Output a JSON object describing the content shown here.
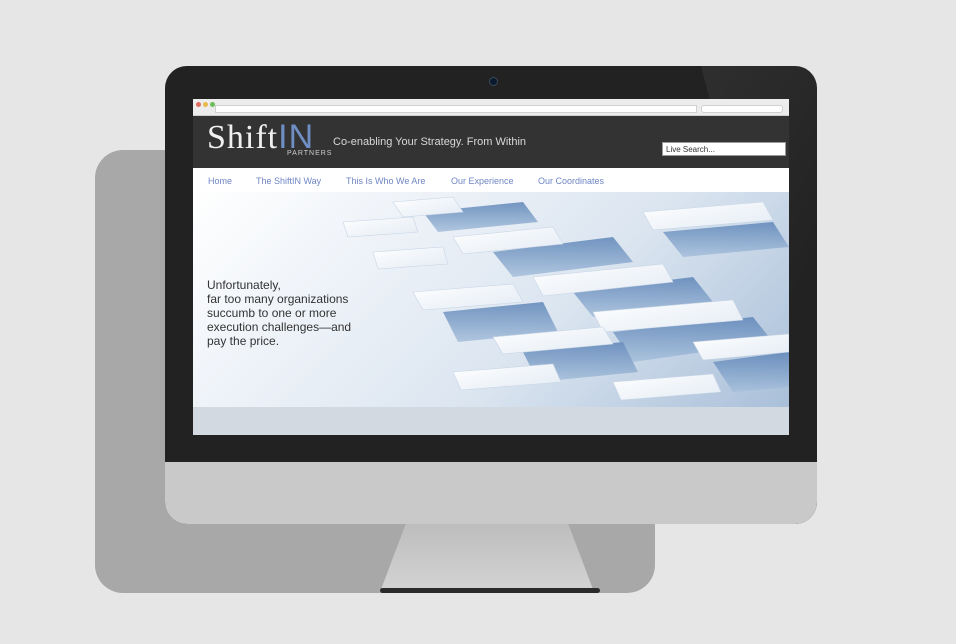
{
  "site": {
    "logo_main": "Shift",
    "logo_accent": "IN",
    "logo_sub": "PARTNERS",
    "tagline": "Co-enabling Your Strategy. From Within",
    "search_placeholder": "Live Search..."
  },
  "nav": {
    "items": [
      "Home",
      "The ShiftIN Way",
      "This Is Who We Are",
      "Our Experience",
      "Our Coordinates"
    ]
  },
  "hero": {
    "lines": [
      "Unfortunately,",
      "far too many organizations",
      "succumb to one or more",
      "execution challenges—and",
      "pay the price."
    ]
  },
  "colors": {
    "nav_link": "#6f86c4",
    "header_bg": "#333333",
    "accent": "#6f8fc4"
  }
}
